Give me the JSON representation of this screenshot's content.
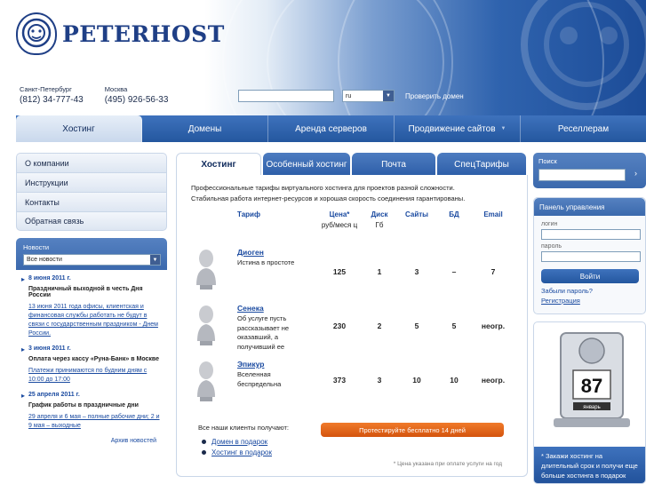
{
  "brand": {
    "name": "PETERHOST"
  },
  "contacts": [
    {
      "city": "Санкт-Петербург",
      "phone": "(812) 34-777-43"
    },
    {
      "city": "Москва",
      "phone": "(495) 926-56-33"
    }
  ],
  "domain_check": {
    "input_value": "",
    "zone": "ru",
    "button": "Проверить домен"
  },
  "main_nav": [
    {
      "label": "Хостинг",
      "active": true
    },
    {
      "label": "Домены"
    },
    {
      "label": "Аренда серверов"
    },
    {
      "label": "Продвижение сайтов",
      "has_dropdown": true
    },
    {
      "label": "Реселлерам"
    }
  ],
  "left_menu": [
    "О компании",
    "Инструкции",
    "Контакты",
    "Обратная связь"
  ],
  "news": {
    "title": "Новости",
    "filter": "Все новости",
    "items": [
      {
        "date": "8 июня 2011 г.",
        "title": "Праздничный выходной в честь Дня России",
        "link": "13 июня 2011 года офисы, клиентская и финансовая службы работать не будут в связи с государственным праздником - Днем России."
      },
      {
        "date": "3 июня 2011 г.",
        "title": "Оплата через кассу «Руна-Банк» в Москве",
        "link": "Платежи принимаются по будним дням с 10:00 до 17:00"
      },
      {
        "date": "25 апреля 2011 г.",
        "title": "График работы в праздничные дни",
        "link": "29 апреля и 6 мая – полные рабочие дни; 2 и 9 мая – выходные"
      }
    ],
    "archive": "Архив новостей"
  },
  "tabs": [
    {
      "label": "Хостинг",
      "active": true
    },
    {
      "label": "Особенный хостинг"
    },
    {
      "label": "Почта"
    },
    {
      "label": "СпецТарифы"
    }
  ],
  "intro": {
    "line1": "Профессиональные тарифы виртуального хостинга для проектов разной сложности.",
    "line2": "Стабильная работа интернет-ресурсов и хорошая скорость соединения гарантированы."
  },
  "table": {
    "headers": {
      "plan": "Тариф",
      "price": "Цена*",
      "price_unit": "руб/меся ц",
      "disk": "Диск",
      "disk_unit": "Гб",
      "sites": "Сайты",
      "db": "БД",
      "email": "Email"
    },
    "rows": [
      {
        "name": "Диоген",
        "desc": "Истина в простоте",
        "price": "125",
        "disk": "1",
        "sites": "3",
        "db": "–",
        "email": "7"
      },
      {
        "name": "Сенека",
        "desc": "Об услуге пусть рассказывает не оказавший, а получивший ее",
        "price": "230",
        "disk": "2",
        "sites": "5",
        "db": "5",
        "email": "неогр."
      },
      {
        "name": "Эпикур",
        "desc": "Вселенная беспредельна",
        "price": "373",
        "disk": "3",
        "sites": "10",
        "db": "10",
        "email": "неогр."
      }
    ]
  },
  "clients_text": "Все наши клиенты получают:",
  "gifts": [
    "Домен в подарок",
    "Хостинг в подарок"
  ],
  "trial_button": "Протестируйте бесплатно 14 дней",
  "footnote": "* Цена указана при оплате услуги на год",
  "search": {
    "title": "Поиск"
  },
  "control_panel": {
    "title": "Панель управления",
    "login_label": "логин",
    "password_label": "пароль",
    "login_button": "Войти",
    "forgot": "Забыли пароль?",
    "register": "Регистрация"
  },
  "promo": {
    "calendar_number": "87",
    "calendar_month": "январь",
    "text": "* Закажи хостинг на длительный срок и получи еще больше хостинга в подарок"
  },
  "colors": {
    "brand_blue": "#1f3f86",
    "nav_blue": "#2d5ea8",
    "accent_orange": "#e0631a",
    "link": "#1a4aa0"
  }
}
